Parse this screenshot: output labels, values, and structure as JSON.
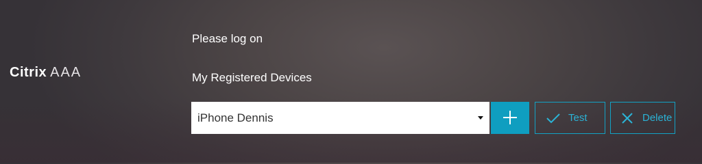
{
  "brand": {
    "name_strong": "Citrix",
    "name_light": "AAA"
  },
  "page": {
    "heading": "Please log on",
    "devices_label": "My Registered Devices"
  },
  "device_select": {
    "selected_value": "iPhone Dennis"
  },
  "actions": {
    "test_label": "Test",
    "delete_label": "Delete"
  },
  "icons": {
    "add": "plus-icon",
    "test": "check-icon",
    "delete": "x-icon",
    "select": "caret-down-icon"
  },
  "colors": {
    "accent": "#0f9ec0",
    "accent_text": "#2bb3d6",
    "background": "#4c4546"
  }
}
